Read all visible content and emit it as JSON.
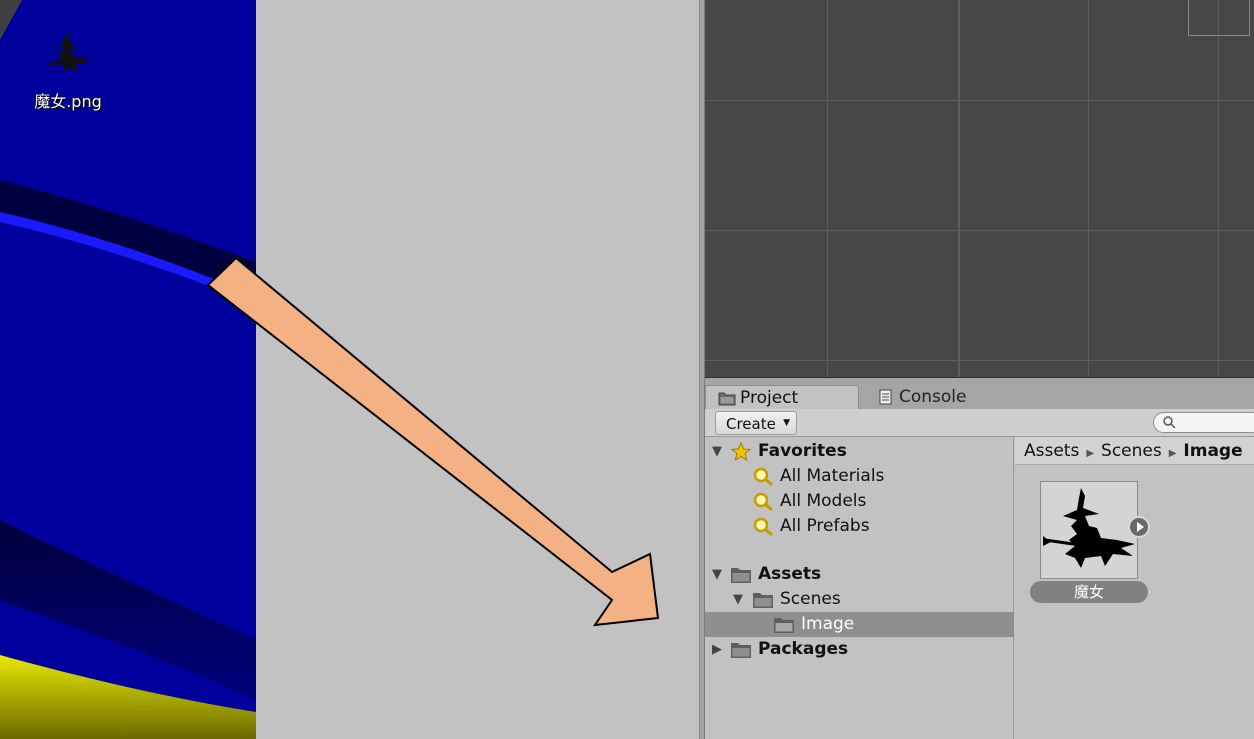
{
  "desktop": {
    "icon_label": "魔女.png",
    "wallpaper_colors": [
      "#00009c",
      "#0000ff",
      "#c8c800"
    ]
  },
  "annotation": {
    "arrow_fill": "#f4b183",
    "arrow_stroke": "#000000"
  },
  "tabs": [
    {
      "label": "Project",
      "icon": "folder-icon",
      "active": true
    },
    {
      "label": "Console",
      "icon": "console-icon",
      "active": false
    }
  ],
  "toolbar": {
    "create_label": "Create",
    "search_placeholder": ""
  },
  "tree": {
    "favorites": {
      "label": "Favorites",
      "items": [
        "All Materials",
        "All Models",
        "All Prefabs"
      ]
    },
    "assets": {
      "label": "Assets",
      "children": [
        {
          "label": "Scenes",
          "children": [
            {
              "label": "Image",
              "selected": true
            }
          ]
        }
      ]
    },
    "packages": {
      "label": "Packages"
    }
  },
  "breadcrumb": [
    "Assets",
    "Scenes",
    "Image"
  ],
  "asset": {
    "name": "魔女",
    "icon": "witch-silhouette-icon"
  },
  "colors": {
    "scene_bg": "#474747",
    "panel_bg": "#c2c2c2",
    "selection": "#8f8f8f"
  }
}
